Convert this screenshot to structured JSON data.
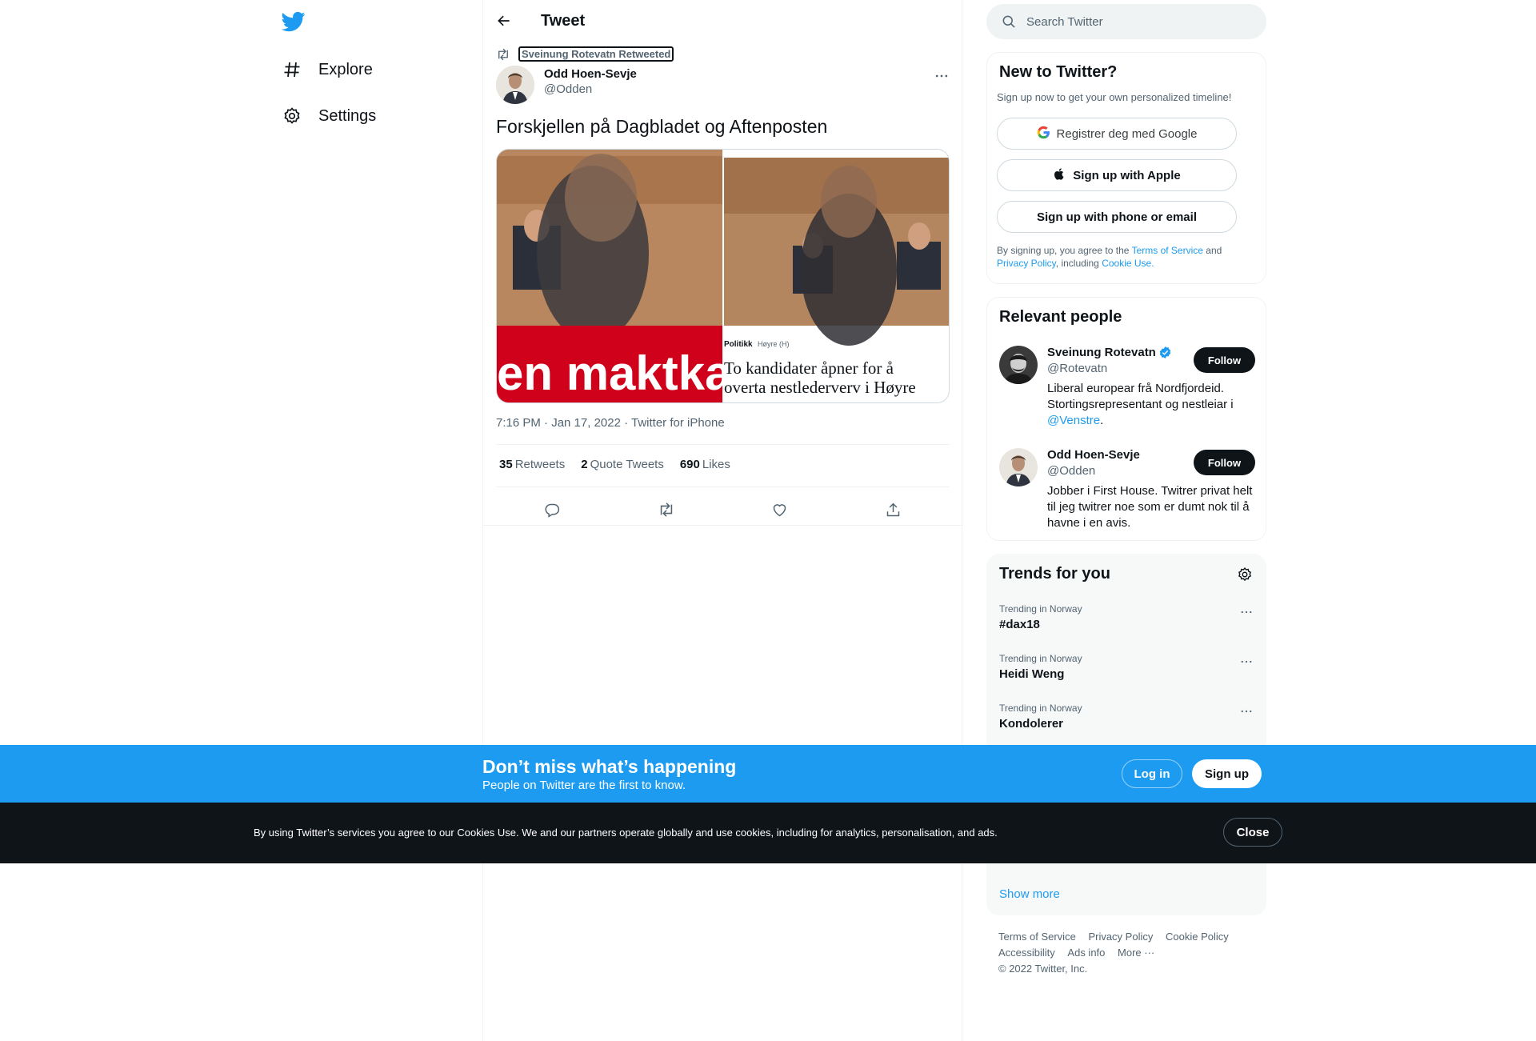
{
  "nav": {
    "items": [
      {
        "label": "Explore",
        "icon": "hashtag-icon"
      },
      {
        "label": "Settings",
        "icon": "gear-icon"
      }
    ]
  },
  "header": {
    "title": "Tweet"
  },
  "tweet": {
    "retweeted_by": "Sveinung Rotevatn Retweeted",
    "author_name": "Odd Hoen-Sevje",
    "author_handle": "@Odden",
    "text": "Forskjellen på Dagbladet og Aftenposten",
    "media": {
      "left_banner_text": "en maktka",
      "right_kicker": "Politikk",
      "right_tag": "Høyre (H)",
      "right_headline_line1": "To kandidater åpner for å",
      "right_headline_line2": "overta nestlederverv i Høyre"
    },
    "meta": "7:16 PM · Jan 17, 2022 · Twitter for iPhone",
    "retweets": "35",
    "retweets_label": "Retweets",
    "quote_tweets": "2",
    "quote_tweets_label": "Quote Tweets",
    "likes": "690",
    "likes_label": "Likes"
  },
  "search": {
    "placeholder": "Search Twitter"
  },
  "new_to_twitter": {
    "title": "New to Twitter?",
    "subtitle": "Sign up now to get your own personalized timeline!",
    "google_label": "Registrer deg med Google",
    "apple_label": "Sign up with Apple",
    "phone_label": "Sign up with phone or email",
    "terms_prefix": "By signing up, you agree to the",
    "terms_link": "Terms of Service",
    "terms_and": "and",
    "privacy_link": "Privacy Policy",
    "terms_including": ", including",
    "cookie_link": "Cookie Use."
  },
  "relevant_people": {
    "title": "Relevant people",
    "people": [
      {
        "name": "Sveinung Rotevatn",
        "handle": "@Rotevatn",
        "bio": "Liberal europear frå Nordfjordeid. Stortingsrepresentant og nestleiar i",
        "bio_link": "@Venstre",
        "bio_end": ".",
        "follow_label": "Follow",
        "verified": true
      },
      {
        "name": "Odd Hoen-Sevje",
        "handle": "@Odden",
        "bio": "Jobber i First House. Twitrer privat helt til jeg twitrer noe som er dumt nok til å havne i en avis.",
        "follow_label": "Follow",
        "verified": false
      }
    ]
  },
  "trends": {
    "title": "Trends for you",
    "items": [
      {
        "context": "Trending in Norway",
        "name": "#dax18"
      },
      {
        "context": "Trending in Norway",
        "name": "Heidi Weng"
      },
      {
        "context": "Trending in Norway",
        "name": "Kondolerer"
      }
    ],
    "show_more": "Show more"
  },
  "footer": {
    "links": [
      "Terms of Service",
      "Privacy Policy",
      "Cookie Policy",
      "Accessibility",
      "Ads info",
      "More ···"
    ],
    "copyright": "© 2022 Twitter, Inc."
  },
  "signup_bar": {
    "title": "Don’t miss what’s happening",
    "subtitle": "People on Twitter are the first to know.",
    "login_label": "Log in",
    "signup_label": "Sign up"
  },
  "cookie_bar": {
    "text": "By using Twitter’s services you agree to our Cookies Use. We and our partners operate globally and use cookies, including for analytics, personalisation, and ads.",
    "close_label": "Close"
  },
  "colors": {
    "accent": "#1d9bf0",
    "text": "#0f1419",
    "muted": "#536471",
    "cookie_bg": "#0f1419"
  }
}
